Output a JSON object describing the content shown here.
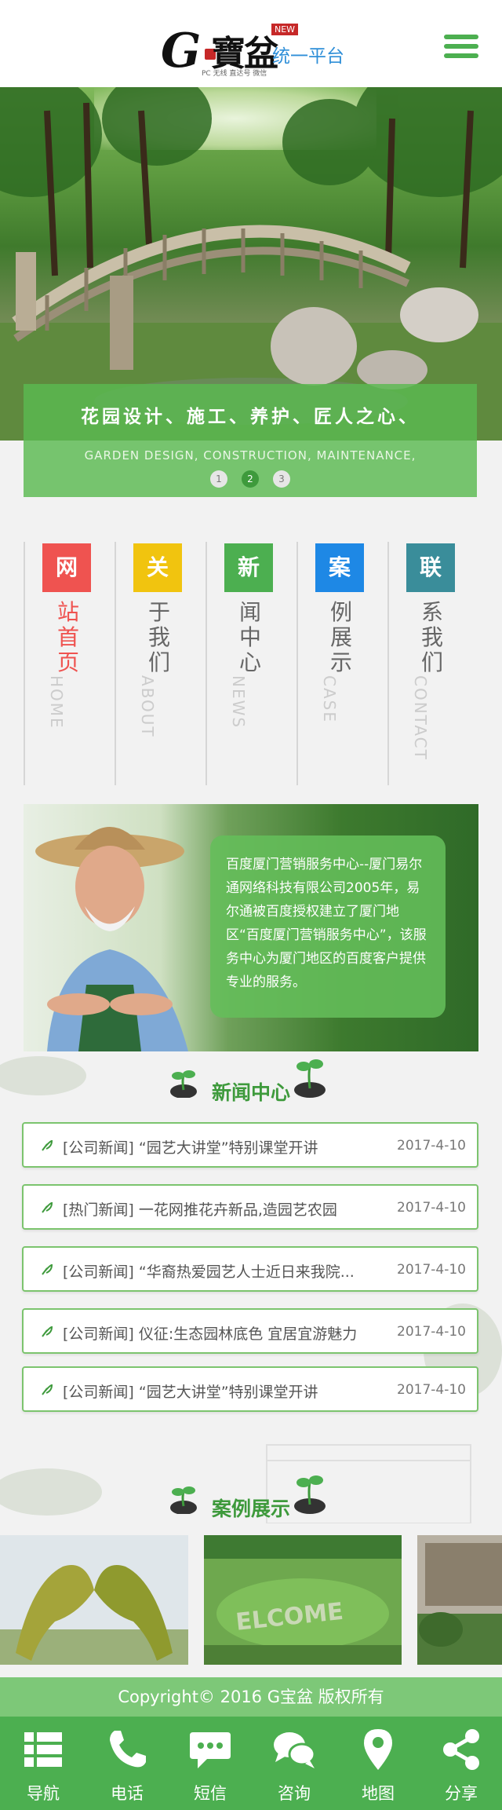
{
  "header": {
    "logo_g": "G",
    "logo_bao": "寶盆",
    "logo_new": "NEW",
    "logo_platform": "统一平台",
    "logo_sub": "PC  无线  直达号  微信",
    "menu_icon": "hamburger-menu-icon"
  },
  "banner": {
    "slogan_cn": "花园设计、施工、养护、匠人之心、",
    "slogan_en": "GARDEN DESIGN, CONSTRUCTION, MAINTENANCE,",
    "pager": [
      "1",
      "2",
      "3"
    ],
    "active_page": 2
  },
  "nav": [
    {
      "first": "网",
      "rest": [
        "站",
        "首",
        "页"
      ],
      "en": "HOME",
      "color": "#ef5350",
      "rest_color": "#ef5350"
    },
    {
      "first": "关",
      "rest": [
        "于",
        "我",
        "们"
      ],
      "en": "ABOUT",
      "color": "#f1c40f",
      "rest_color": "#666666"
    },
    {
      "first": "新",
      "rest": [
        "闻",
        "中",
        "心"
      ],
      "en": "NEWS",
      "color": "#4caf50",
      "rest_color": "#666666"
    },
    {
      "first": "案",
      "rest": [
        "例",
        "展",
        "示"
      ],
      "en": "CASE",
      "color": "#1e88e5",
      "rest_color": "#666666"
    },
    {
      "first": "联",
      "rest": [
        "系",
        "我",
        "们"
      ],
      "en": "CONTACT",
      "color": "#3a8d9a",
      "rest_color": "#666666"
    }
  ],
  "about": {
    "text": "百度厦门营销服务中心--厦门易尔通网络科技有限公司2005年，易尔通被百度授权建立了厦门地区“百度厦门营销服务中心”，该服务中心为厦门地区的百度客户提供专业的服务。"
  },
  "news": {
    "title": "新闻中心",
    "items": [
      {
        "title": "[公司新闻] “园艺大讲堂”特别课堂开讲",
        "date": "2017-4-10"
      },
      {
        "title": "[热门新闻] 一花网推花卉新品,造园艺农园",
        "date": "2017-4-10"
      },
      {
        "title": "[公司新闻] “华裔热爱园艺人士近日来我院...",
        "date": "2017-4-10"
      },
      {
        "title": "[公司新闻] 仪征:生态园林底色 宜居宜游魅力",
        "date": "2017-4-10"
      },
      {
        "title": "[公司新闻] “园艺大讲堂”特别课堂开讲",
        "date": "2017-4-10"
      }
    ]
  },
  "cases": {
    "title": "案例展示"
  },
  "footer": {
    "copyright": "Copyright© 2016  G宝盆 版权所有",
    "bottom_nav": [
      {
        "label": "导航",
        "icon": "list-icon"
      },
      {
        "label": "电话",
        "icon": "phone-icon"
      },
      {
        "label": "短信",
        "icon": "message-icon"
      },
      {
        "label": "咨询",
        "icon": "chat-icon"
      },
      {
        "label": "地图",
        "icon": "map-pin-icon"
      },
      {
        "label": "分享",
        "icon": "share-icon"
      }
    ]
  }
}
